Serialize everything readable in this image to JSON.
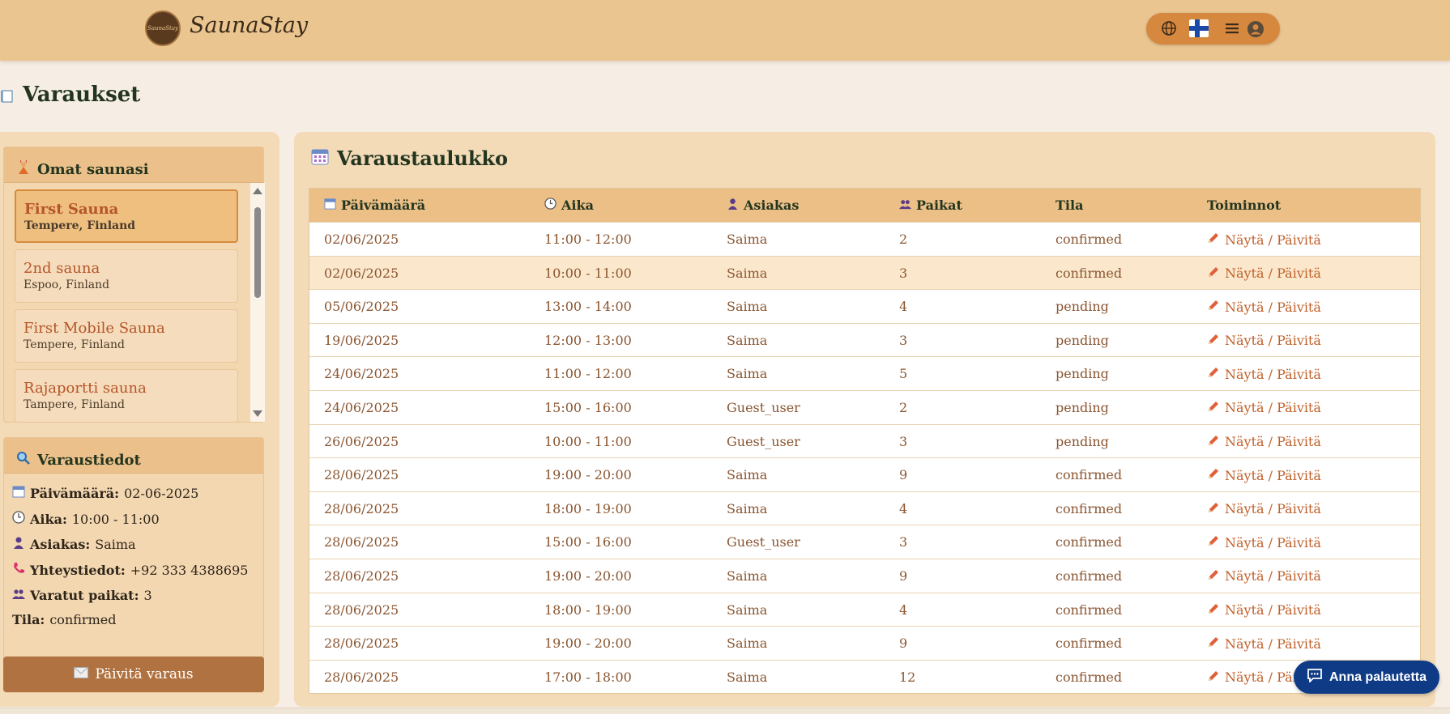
{
  "header": {
    "logo_text": "SaunaStay",
    "brand": "SaunaStay",
    "icons": [
      "globe-icon",
      "finland-flag-icon",
      "menu-icon",
      "user-icon"
    ]
  },
  "page": {
    "title": "Varaukset",
    "title_icon": "book-icon"
  },
  "saunas": {
    "heading": "Omat saunasi",
    "heading_icon": "sauna-person-icon",
    "items": [
      {
        "name": "First Sauna",
        "location": "Tempere, Finland",
        "active": true
      },
      {
        "name": "2nd sauna",
        "location": "Espoo, Finland",
        "active": false
      },
      {
        "name": "First Mobile Sauna",
        "location": "Tempere, Finland",
        "active": false
      },
      {
        "name": "Rajaportti sauna",
        "location": "Tampere, Finland",
        "active": false
      }
    ]
  },
  "details": {
    "heading": "Varaustiedot",
    "heading_icon": "magnifier-icon",
    "date_label": "Päivämäärä:",
    "date_value": "02-06-2025",
    "time_label": "Aika:",
    "time_value": "10:00 - 11:00",
    "customer_label": "Asiakas:",
    "customer_value": "Saima",
    "contact_label": "Yhteystiedot:",
    "contact_value": "+92 333 4388695",
    "seats_label": "Varatut paikat:",
    "seats_value": "3",
    "status_label": "Tila:",
    "status_value": "confirmed",
    "update_button": "Päivitä varaus"
  },
  "table": {
    "title": "Varaustaulukko",
    "columns": {
      "date": "Päivämäärä",
      "time": "Aika",
      "customer": "Asiakas",
      "seats": "Paikat",
      "status": "Tila",
      "actions": "Toiminnot"
    },
    "action_label": "Näytä / Päivitä",
    "rows": [
      {
        "date": "02/06/2025",
        "time": "11:00 - 12:00",
        "customer": "Saima",
        "seats": "2",
        "status": "confirmed"
      },
      {
        "date": "02/06/2025",
        "time": "10:00 - 11:00",
        "customer": "Saima",
        "seats": "3",
        "status": "confirmed"
      },
      {
        "date": "05/06/2025",
        "time": "13:00 - 14:00",
        "customer": "Saima",
        "seats": "4",
        "status": "pending"
      },
      {
        "date": "19/06/2025",
        "time": "12:00 - 13:00",
        "customer": "Saima",
        "seats": "3",
        "status": "pending"
      },
      {
        "date": "24/06/2025",
        "time": "11:00 - 12:00",
        "customer": "Saima",
        "seats": "5",
        "status": "pending"
      },
      {
        "date": "24/06/2025",
        "time": "15:00 - 16:00",
        "customer": "Guest_user",
        "seats": "2",
        "status": "pending"
      },
      {
        "date": "26/06/2025",
        "time": "10:00 - 11:00",
        "customer": "Guest_user",
        "seats": "3",
        "status": "pending"
      },
      {
        "date": "28/06/2025",
        "time": "19:00 - 20:00",
        "customer": "Saima",
        "seats": "9",
        "status": "confirmed"
      },
      {
        "date": "28/06/2025",
        "time": "18:00 - 19:00",
        "customer": "Saima",
        "seats": "4",
        "status": "confirmed"
      },
      {
        "date": "28/06/2025",
        "time": "15:00 - 16:00",
        "customer": "Guest_user",
        "seats": "3",
        "status": "confirmed"
      },
      {
        "date": "28/06/2025",
        "time": "19:00 - 20:00",
        "customer": "Saima",
        "seats": "9",
        "status": "confirmed"
      },
      {
        "date": "28/06/2025",
        "time": "18:00 - 19:00",
        "customer": "Saima",
        "seats": "4",
        "status": "confirmed"
      },
      {
        "date": "28/06/2025",
        "time": "19:00 - 20:00",
        "customer": "Saima",
        "seats": "9",
        "status": "confirmed"
      },
      {
        "date": "28/06/2025",
        "time": "17:00 - 18:00",
        "customer": "Saima",
        "seats": "12",
        "status": "confirmed"
      }
    ]
  },
  "feedback_button": "Anna palautetta",
  "colors": {
    "header": "#ebc590",
    "accent": "#d6883e",
    "button": "#b07240",
    "feedback": "#0f3b86"
  }
}
